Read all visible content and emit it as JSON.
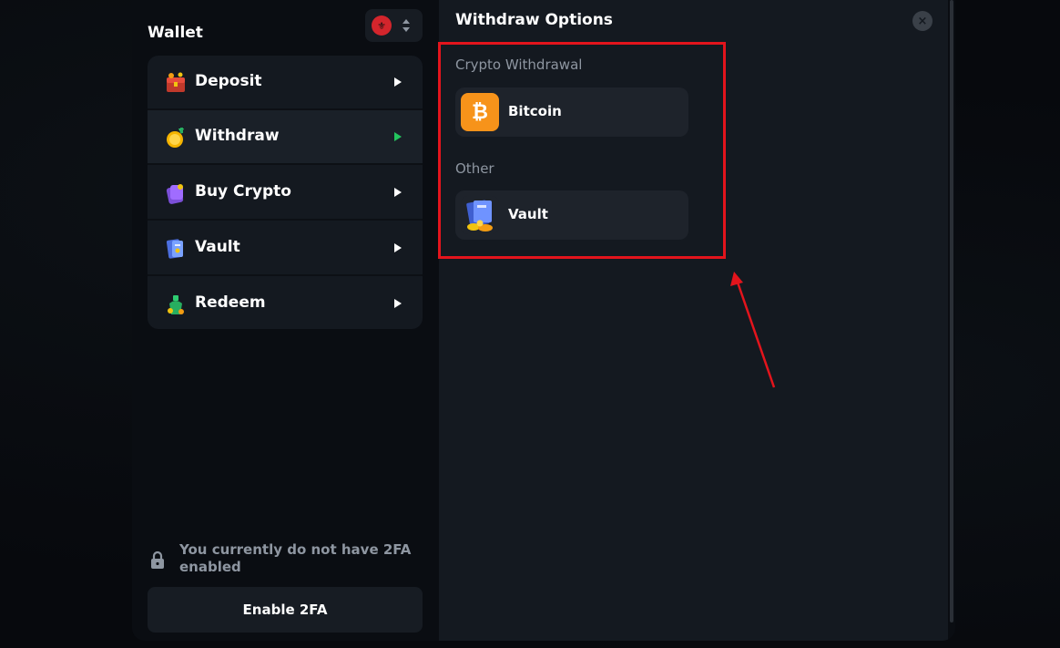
{
  "wallet": {
    "title": "Wallet",
    "currency_flag": "⚜"
  },
  "menu": {
    "items": [
      {
        "label": "Deposit",
        "icon": "deposit-chest-icon",
        "active": false
      },
      {
        "label": "Withdraw",
        "icon": "withdraw-coin-icon",
        "active": true
      },
      {
        "label": "Buy Crypto",
        "icon": "buy-crypto-card-icon",
        "active": false
      },
      {
        "label": "Vault",
        "icon": "vault-icon",
        "active": false
      },
      {
        "label": "Redeem",
        "icon": "redeem-money-icon",
        "active": false
      }
    ]
  },
  "twofa": {
    "message": "You currently do not have 2FA enabled",
    "button_label": "Enable 2FA"
  },
  "withdraw_options": {
    "title": "Withdraw Options",
    "close": "×",
    "crypto_section_label": "Crypto Withdrawal",
    "bitcoin_label": "Bitcoin",
    "bitcoin_symbol": "₿",
    "other_section_label": "Other",
    "vault_label": "Vault"
  },
  "colors": {
    "accent_green": "#23c55e",
    "bitcoin_orange": "#f7931a",
    "annotation_red": "#e3141c"
  }
}
